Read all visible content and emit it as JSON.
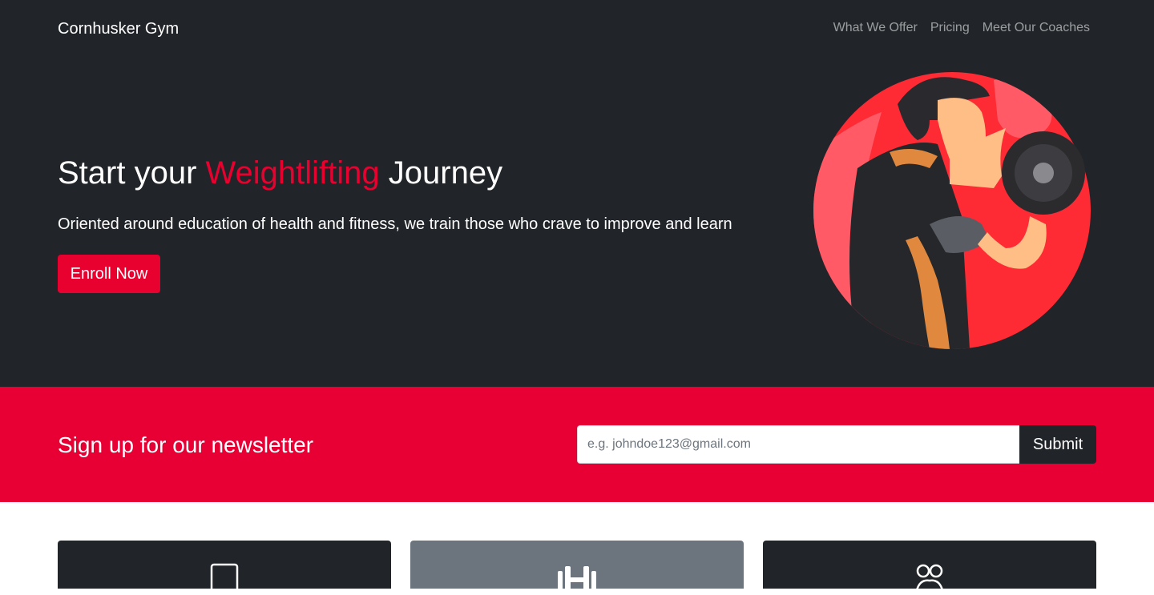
{
  "navbar": {
    "brand": "Cornhusker Gym",
    "links": [
      "What We Offer",
      "Pricing",
      "Meet Our Coaches"
    ]
  },
  "hero": {
    "headline_pre": "Start your ",
    "headline_accent": "Weightlifting",
    "headline_post": " Journey",
    "subtitle": "Oriented around education of health and fitness, we train those who crave to improve and learn",
    "cta_label": "Enroll Now",
    "illustration": "man-lifting-dumbbell-illustration"
  },
  "newsletter": {
    "title": "Sign up for our newsletter",
    "email_placeholder": "e.g. johndoe123@gmail.com",
    "submit_label": "Submit"
  },
  "cards": [
    {
      "icon": "tablet-icon"
    },
    {
      "icon": "dumbbell-icon"
    },
    {
      "icon": "people-icon"
    }
  ],
  "colors": {
    "dark": "#212529",
    "accent": "#e8002f",
    "newsletter_bg": "#e80035",
    "muted": "#6c757d"
  }
}
